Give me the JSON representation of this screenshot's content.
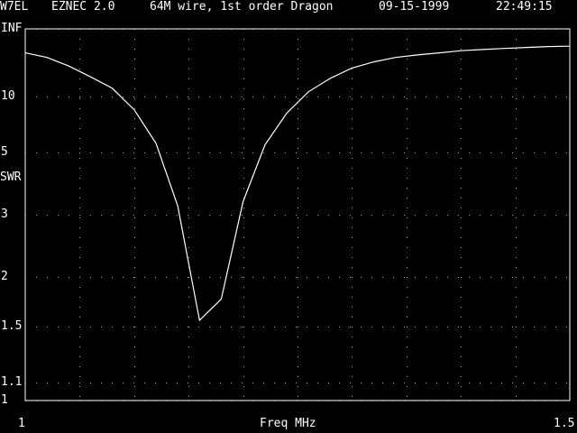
{
  "header": {
    "callsign": "W7EL",
    "program": "EZNEC 2.0",
    "title": "64M wire, 1st order Dragon",
    "date": "09-15-1999",
    "time": "22:49:15"
  },
  "colors": {
    "background": "#000000",
    "foreground": "#ffffff",
    "grid": "#aaaaaa"
  },
  "chart_data": {
    "type": "line",
    "title": "64M wire, 1st order Dragon",
    "xlabel": "Freq MHz",
    "ylabel": "SWR",
    "xlim": [
      1,
      1.5
    ],
    "y_scale": "reflection-coefficient (SWR)",
    "y_ticks": [
      "INF",
      "10",
      "5",
      "3",
      "2",
      "1.5",
      "1.1",
      "1"
    ],
    "x_ticks": [
      "1",
      "1.5"
    ],
    "grid": true,
    "series": [
      {
        "x": [
          1.0,
          1.02,
          1.04,
          1.06,
          1.08,
          1.1,
          1.12,
          1.14,
          1.16,
          1.18,
          1.2,
          1.22,
          1.24,
          1.26,
          1.28,
          1.3,
          1.32,
          1.34,
          1.36,
          1.38,
          1.4,
          1.42,
          1.44,
          1.46,
          1.48,
          1.5
        ],
        "y": [
          30,
          25,
          19,
          14.5,
          11.5,
          8.2,
          5.5,
          3.2,
          1.55,
          1.75,
          3.3,
          5.4,
          7.8,
          10.8,
          14,
          18,
          21.5,
          25,
          27.5,
          30,
          33,
          35,
          37,
          39,
          41,
          42
        ]
      }
    ]
  }
}
